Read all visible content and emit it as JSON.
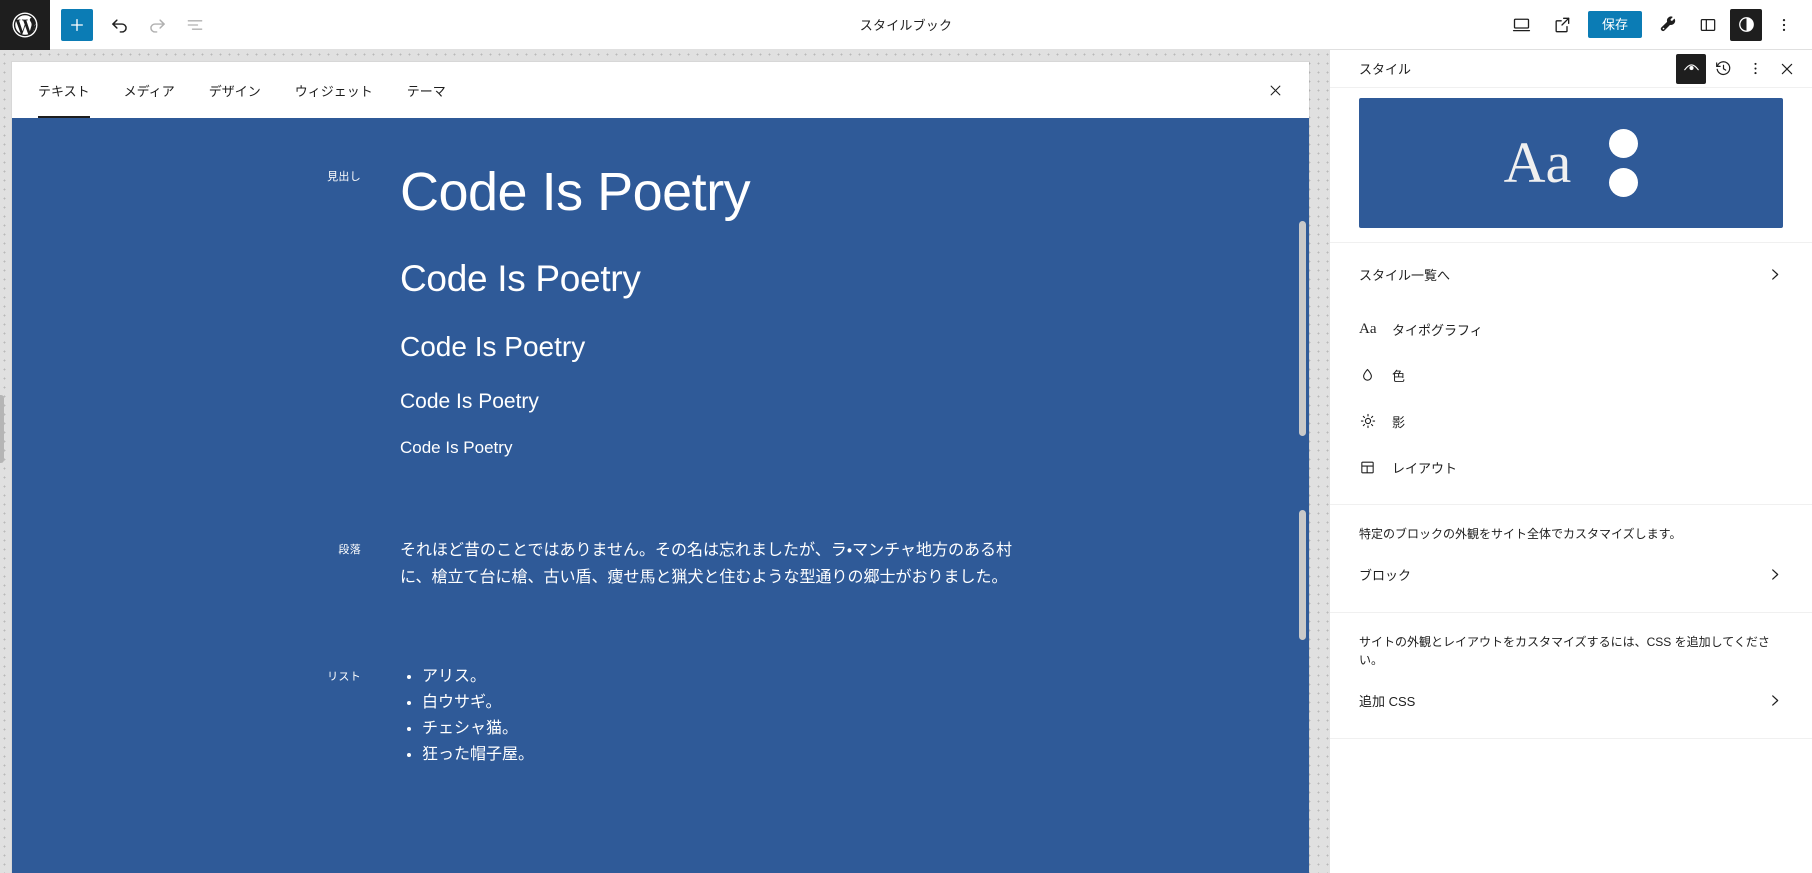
{
  "toolbar": {
    "logo_icon": "wordpress-logo-icon",
    "inserter_icon": "plus-icon",
    "undo_icon": "undo-arrow-icon",
    "redo_icon": "redo-arrow-icon",
    "list_view_icon": "list-view-icon",
    "title": "スタイルブック",
    "device_icon": "desktop-icon",
    "preview_icon": "external-link-icon",
    "save_label": "保存",
    "tools_icon": "wrench-icon",
    "sidebar_icon": "sidebar-panel-icon",
    "styles_icon": "contrast-circle-icon",
    "more_icon": "three-dots-vertical-icon"
  },
  "stylebook": {
    "tabs": [
      {
        "label": "テキスト",
        "active": true
      },
      {
        "label": "メディア",
        "active": false
      },
      {
        "label": "デザイン",
        "active": false
      },
      {
        "label": "ウィジェット",
        "active": false
      },
      {
        "label": "テーマ",
        "active": false
      }
    ],
    "close_icon": "close-x-icon",
    "background_color": "#2f5a98",
    "sections": {
      "heading": {
        "label": "見出し",
        "h1": "Code Is Poetry",
        "h2": "Code Is Poetry",
        "h3": "Code Is Poetry",
        "h4": "Code Is Poetry",
        "h5": "Code Is Poetry"
      },
      "paragraph": {
        "label": "段落",
        "text": "それほど昔のことではありません。その名は忘れましたが、ラ・マンチャ地方のある村に、槍立て台に槍、古い盾、痩せ馬と猟犬と住むような型通りの郷士がおりました。"
      },
      "list": {
        "label": "リスト",
        "items": [
          "アリス。",
          "白ウサギ。",
          "チェシャ猫。",
          "狂った帽子屋。"
        ]
      }
    }
  },
  "sidebar": {
    "title": "スタイル",
    "actions": {
      "preview_icon": "style-preview-eye-icon",
      "revisions_icon": "revision-history-icon",
      "more_icon": "three-dots-vertical-icon",
      "close_icon": "close-x-icon"
    },
    "preview_card": {
      "sample_text": "Aa",
      "background_color": "#2f5a98",
      "dot_color": "#ffffff"
    },
    "browse_styles": {
      "label": "スタイル一覧へ",
      "chevron_icon": "chevron-right-icon"
    },
    "items": [
      {
        "label": "タイポグラフィ",
        "icon": "typography-aa-icon"
      },
      {
        "label": "色",
        "icon": "color-droplet-icon"
      },
      {
        "label": "影",
        "icon": "shadow-sun-icon"
      },
      {
        "label": "レイアウト",
        "icon": "layout-icon"
      }
    ],
    "blocks_section": {
      "description": "特定のブロックの外観をサイト全体でカスタマイズします。",
      "label": "ブロック",
      "chevron_icon": "chevron-right-icon"
    },
    "css_section": {
      "description": "サイトの外観とレイアウトをカスタマイズするには、CSS を追加してください。",
      "label": "追加 CSS",
      "chevron_icon": "chevron-right-icon"
    }
  }
}
